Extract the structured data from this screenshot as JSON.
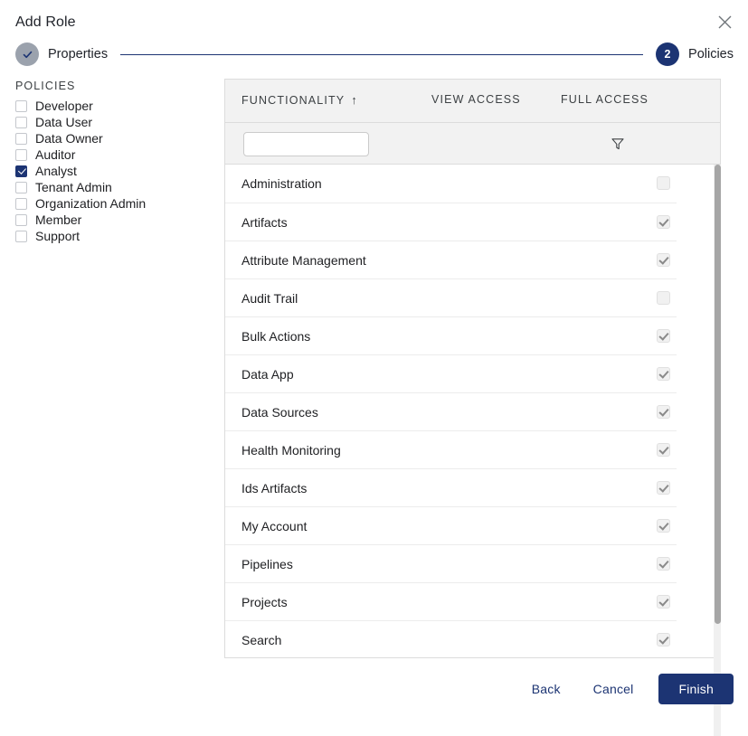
{
  "dialog": {
    "title": "Add Role",
    "close_icon": "close-icon"
  },
  "stepper": {
    "steps": [
      {
        "marker": "✓",
        "label": "Properties",
        "state": "done"
      },
      {
        "marker": "2",
        "label": "Policies",
        "state": "current"
      }
    ],
    "accent_color": "#1c3473",
    "done_color": "#9ba2ad"
  },
  "policies": {
    "heading": "POLICIES",
    "items": [
      {
        "label": "Developer",
        "checked": false
      },
      {
        "label": "Data User",
        "checked": false
      },
      {
        "label": "Data Owner",
        "checked": false
      },
      {
        "label": "Auditor",
        "checked": false
      },
      {
        "label": "Analyst",
        "checked": true
      },
      {
        "label": "Tenant Admin",
        "checked": false
      },
      {
        "label": "Organization Admin",
        "checked": false
      },
      {
        "label": "Member",
        "checked": false
      },
      {
        "label": "Support",
        "checked": false
      }
    ]
  },
  "table": {
    "columns": [
      {
        "label": "FUNCTIONALITY",
        "sort": "↑"
      },
      {
        "label": "VIEW ACCESS",
        "sort": ""
      },
      {
        "label": "FULL ACCESS",
        "sort": ""
      }
    ],
    "filter": {
      "value": "",
      "placeholder": "",
      "icon": "funnel-icon"
    },
    "rows": [
      {
        "functionality": "Administration",
        "view_access": false,
        "full_access": false
      },
      {
        "functionality": "Artifacts",
        "view_access": true,
        "full_access": false
      },
      {
        "functionality": "Attribute Management",
        "view_access": true,
        "full_access": true
      },
      {
        "functionality": "Audit Trail",
        "view_access": false,
        "full_access": false
      },
      {
        "functionality": "Bulk Actions",
        "view_access": true,
        "full_access": true
      },
      {
        "functionality": "Data App",
        "view_access": true,
        "full_access": true
      },
      {
        "functionality": "Data Sources",
        "view_access": true,
        "full_access": false
      },
      {
        "functionality": "Health Monitoring",
        "view_access": true,
        "full_access": true
      },
      {
        "functionality": "Ids Artifacts",
        "view_access": true,
        "full_access": false
      },
      {
        "functionality": "My Account",
        "view_access": true,
        "full_access": true
      },
      {
        "functionality": "Pipelines",
        "view_access": true,
        "full_access": true
      },
      {
        "functionality": "Projects",
        "view_access": true,
        "full_access": false
      },
      {
        "functionality": "Search",
        "view_access": true,
        "full_access": true
      }
    ]
  },
  "footer": {
    "back_label": "Back",
    "cancel_label": "Cancel",
    "finish_label": "Finish"
  }
}
